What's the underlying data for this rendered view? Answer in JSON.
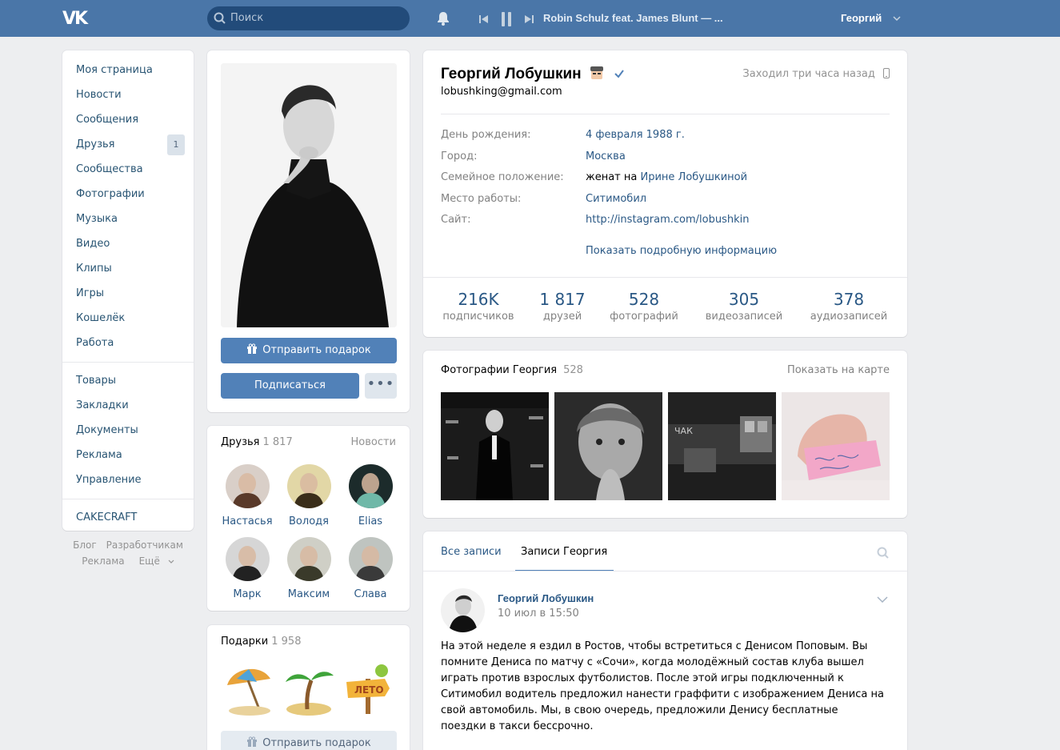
{
  "header": {
    "logo": "VK",
    "search_placeholder": "Поиск",
    "track": "Robin Schulz feat. James Blunt — ...",
    "user_name": "Георгий"
  },
  "nav": {
    "items": [
      {
        "label": "Моя страница"
      },
      {
        "label": "Новости"
      },
      {
        "label": "Сообщения"
      },
      {
        "label": "Друзья",
        "badge": "1"
      },
      {
        "label": "Сообщества"
      },
      {
        "label": "Фотографии"
      },
      {
        "label": "Музыка"
      },
      {
        "label": "Видео"
      },
      {
        "label": "Клипы"
      },
      {
        "label": "Игры"
      },
      {
        "label": "Кошелёк"
      },
      {
        "label": "Работа"
      }
    ],
    "items2": [
      {
        "label": "Товары"
      },
      {
        "label": "Закладки"
      },
      {
        "label": "Документы"
      },
      {
        "label": "Реклама"
      },
      {
        "label": "Управление"
      }
    ],
    "items3": [
      {
        "label": "CAKECRAFT"
      }
    ],
    "footer": [
      "Блог",
      "Разработчикам",
      "Реклама",
      "Ещё"
    ]
  },
  "avatar_card": {
    "gift_button": "Отправить подарок",
    "subscribe_button": "Подписаться",
    "more_button": "•••"
  },
  "friends": {
    "title": "Друзья",
    "count": "1 817",
    "link": "Новости",
    "list": [
      {
        "name": "Настасья"
      },
      {
        "name": "Володя"
      },
      {
        "name": "Elias"
      },
      {
        "name": "Марк"
      },
      {
        "name": "Максим"
      },
      {
        "name": "Слава"
      }
    ]
  },
  "gifts": {
    "title": "Подарки",
    "count": "1 958",
    "button": "Отправить подарок"
  },
  "profile": {
    "name": "Георгий Лобушкин",
    "email": "lobushking@gmail.com",
    "online": "Заходил три часа назад",
    "fields": [
      {
        "label": "День рождения:",
        "value": "4 февраля 1988 г."
      },
      {
        "label": "Город:",
        "value": "Москва"
      },
      {
        "label": "Семейное положение:",
        "value_prefix": "женат на ",
        "value": "Ирине Лобушкиной"
      },
      {
        "label": "Место работы:",
        "value": "Ситимобил"
      },
      {
        "label": "Сайт:",
        "value": "http://instagram.com/lobushkin"
      }
    ],
    "more_info": "Показать подробную информацию",
    "stats": [
      {
        "n": "216K",
        "l": "подписчиков"
      },
      {
        "n": "1 817",
        "l": "друзей"
      },
      {
        "n": "528",
        "l": "фотографий"
      },
      {
        "n": "305",
        "l": "видеозаписей"
      },
      {
        "n": "378",
        "l": "аудиозаписей"
      }
    ]
  },
  "photos": {
    "title": "Фотографии Георгия",
    "count": "528",
    "map_link": "Показать на карте"
  },
  "posts": {
    "tab_all": "Все записи",
    "tab_own": "Записи Георгия",
    "author": "Георгий Лобушкин",
    "date": "10 июл в 15:50",
    "text": "На этой неделе я ездил в Ростов, чтобы встретиться с Денисом Поповым. Вы\nпомните Дениса по матчу с «Сочи», когда молодёжный состав клуба вышел\nиграть против взрослых футболистов. После этой игры подключенный к\nСитимобил водитель предложил нанести граффити с изображением Дениса на\nсвой автомобиль. Мы, в свою очередь, предложили Денису бесплатные\nпоездки в такси бессрочно."
  }
}
